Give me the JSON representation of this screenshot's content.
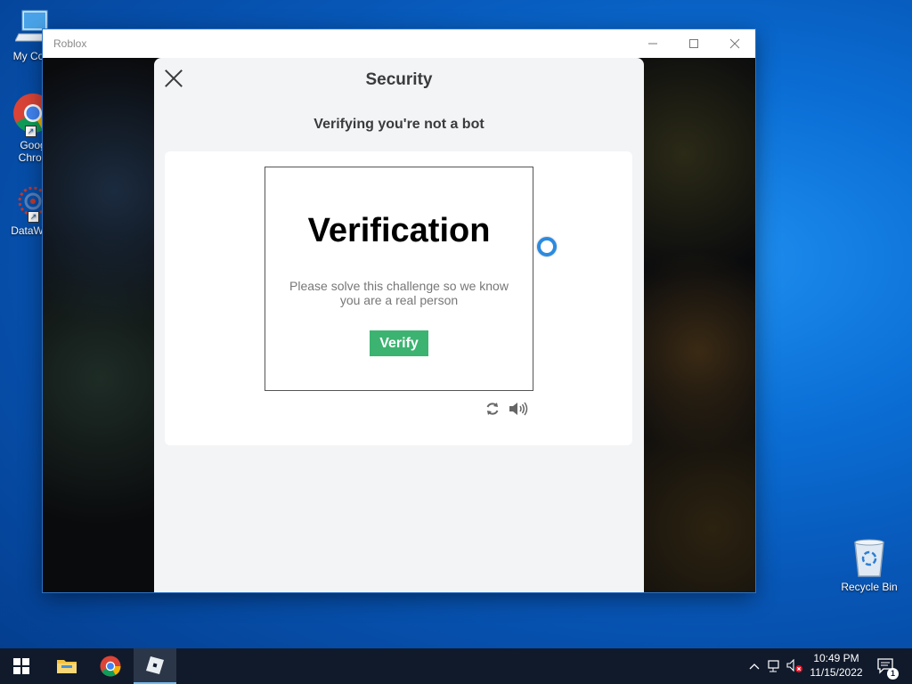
{
  "desktop": {
    "icons": [
      {
        "label": "My Com",
        "icon": "computer-icon"
      },
      {
        "label": "Goog\nChron",
        "icon": "chrome-icon"
      },
      {
        "label": "DataWag",
        "icon": "datawag-icon"
      }
    ],
    "recycle_bin": {
      "label": "Recycle Bin",
      "icon": "recycle-bin-icon"
    }
  },
  "window": {
    "title": "Roblox",
    "controls": [
      "minimize",
      "maximize",
      "close"
    ]
  },
  "modal": {
    "title": "Security",
    "subtitle": "Verifying you're not a bot",
    "challenge": {
      "heading": "Verification",
      "description": "Please solve this challenge so we know you are a real person",
      "button_label": "Verify",
      "button_color": "#3cb371"
    },
    "icons": [
      "refresh-icon",
      "audio-icon"
    ]
  },
  "taskbar": {
    "pinned": [
      "windows-start-icon",
      "file-explorer-icon",
      "chrome-icon",
      "roblox-icon"
    ],
    "clock": {
      "time": "10:49 PM",
      "date": "11/15/2022"
    },
    "notification_count": "1"
  },
  "colors": {
    "desktop_accent": "#0b6fd6",
    "taskbar": "#101a2b",
    "modal_bg": "#f2f4f5",
    "text_dark": "#393b3d"
  }
}
